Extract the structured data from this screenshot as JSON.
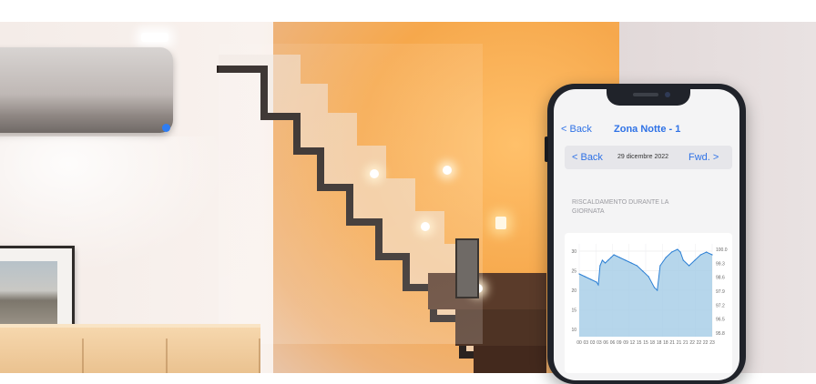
{
  "app": {
    "back_label": "< Back",
    "title": "Zona Notte - 1"
  },
  "date_nav": {
    "prev_label": "< Back",
    "date": "29 dicembre 2022",
    "next_label": "Fwd. >"
  },
  "chart_caption": "RISCALDAMENTO DURANTE LA GIORNATA",
  "colors": {
    "accent": "#2f72e6",
    "series_line": "#2b7fd4",
    "series_fill": "#a9cfe8",
    "ac_indicator": "#2f7df2"
  },
  "chart_data": {
    "type": "area",
    "title": "",
    "xlabel": "",
    "ylabel": "",
    "x_tick_labels": [
      "00",
      "03",
      "03",
      "03",
      "06",
      "06",
      "09",
      "09",
      "12",
      "15",
      "15",
      "18",
      "18",
      "18",
      "21",
      "21",
      "21",
      "22",
      "22",
      "22",
      "23"
    ],
    "y_left_ticks": [
      "10",
      "15",
      "20",
      "25",
      "30"
    ],
    "y_right_ticks": [
      "100.0",
      "99.3",
      "98.6",
      "97.9",
      "97.2",
      "96.5",
      "95.8"
    ],
    "ylim": [
      0,
      34
    ],
    "grid": true,
    "series": [
      {
        "x": [
          0,
          1,
          2,
          3,
          3.3,
          3.6,
          4,
          4.5,
          5,
          5.5,
          6,
          7,
          8,
          9,
          10,
          11,
          12,
          13,
          13.5,
          14,
          15,
          16,
          17,
          17.5,
          18,
          19,
          20,
          21,
          22,
          23
        ],
        "values": [
          23,
          22,
          21,
          20,
          19,
          26,
          28,
          27,
          28,
          29,
          30,
          29,
          28,
          27,
          26,
          24,
          22,
          18,
          17,
          26,
          29,
          31,
          32,
          31,
          28,
          26,
          28,
          30,
          31,
          30
        ]
      }
    ]
  }
}
